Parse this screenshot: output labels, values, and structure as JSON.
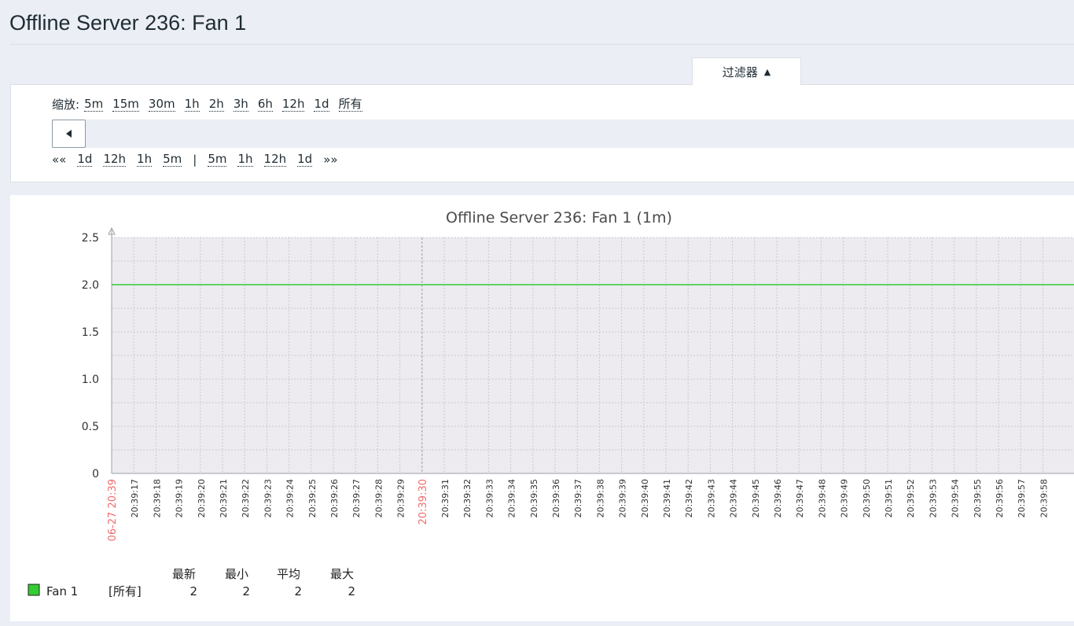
{
  "page": {
    "title": "Offline Server 236: Fan 1"
  },
  "filter": {
    "tab_label": "过滤器",
    "tab_arrow": "▲"
  },
  "zoom": {
    "label": "缩放:",
    "options": [
      "5m",
      "15m",
      "30m",
      "1h",
      "2h",
      "3h",
      "6h",
      "12h",
      "1d",
      "所有"
    ]
  },
  "navigation": {
    "back_fast": "««",
    "back_options": [
      "1d",
      "12h",
      "1h",
      "5m"
    ],
    "separator": "|",
    "forward_options": [
      "5m",
      "1h",
      "12h",
      "1d"
    ],
    "forward_fast": "»»"
  },
  "colors": {
    "series": "#33cc33",
    "highlight_label": "#f26b6b",
    "plot_bg": "#edeaf0",
    "grid": "#c9cbd2"
  },
  "chart_data": {
    "type": "line",
    "title": "Offline Server 236: Fan 1 (1m)",
    "ylim": [
      0,
      2.5
    ],
    "y_ticks": [
      "0",
      "0.5",
      "1.0",
      "1.5",
      "2.0",
      "2.5"
    ],
    "x_labels": [
      "06-27 20:39",
      "20:39:17",
      "20:39:18",
      "20:39:19",
      "20:39:20",
      "20:39:21",
      "20:39:22",
      "20:39:23",
      "20:39:24",
      "20:39:25",
      "20:39:26",
      "20:39:27",
      "20:39:28",
      "20:39:29",
      "20:39:30",
      "20:39:31",
      "20:39:32",
      "20:39:33",
      "20:39:34",
      "20:39:35",
      "20:39:36",
      "20:39:37",
      "20:39:38",
      "20:39:39",
      "20:39:40",
      "20:39:41",
      "20:39:42",
      "20:39:43",
      "20:39:44",
      "20:39:45",
      "20:39:46",
      "20:39:47",
      "20:39:48",
      "20:39:49",
      "20:39:50",
      "20:39:51",
      "20:39:52",
      "20:39:53",
      "20:39:54",
      "20:39:55",
      "20:39:56",
      "20:39:57",
      "20:39:58"
    ],
    "highlighted_x_labels": [
      "06-27 20:39",
      "20:39:30"
    ],
    "series": [
      {
        "name": "Fan 1",
        "values": [
          2,
          2
        ],
        "color": "#33cc33"
      }
    ],
    "grid": true
  },
  "legend": {
    "headers": [
      "最新",
      "最小",
      "平均",
      "最大"
    ],
    "rows": [
      {
        "name": "Fan 1",
        "func": "[所有]",
        "values": [
          "2",
          "2",
          "2",
          "2"
        ],
        "color": "#33cc33"
      }
    ]
  }
}
